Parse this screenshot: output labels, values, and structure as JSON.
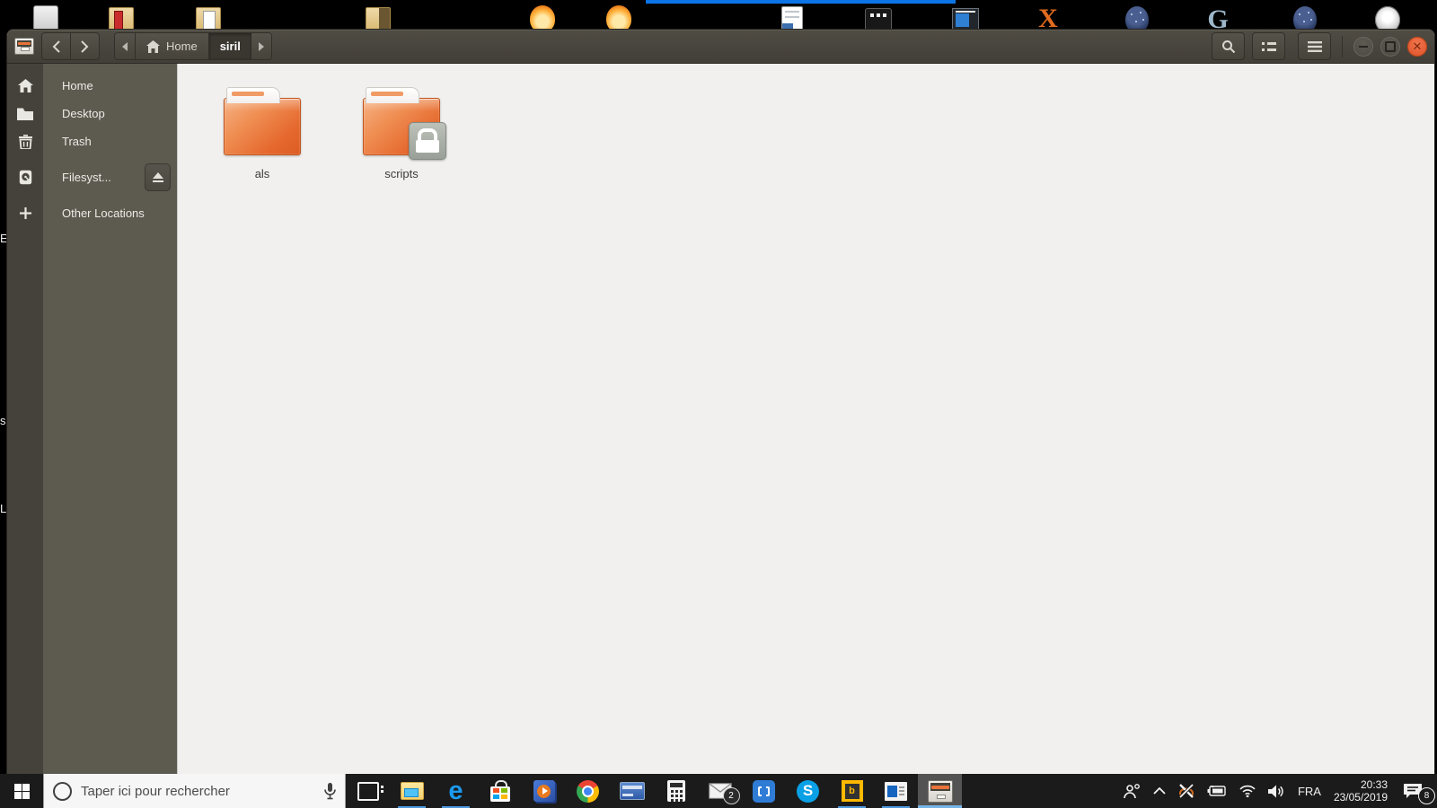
{
  "colors": {
    "accent_blue": "#0d74e8",
    "taskbar_underline": "#4e99dd",
    "close_button": "#dd4f27",
    "folder_orange": "#e5682e",
    "headerbar": "#46433b",
    "sidebar": "#5d5a50",
    "content_bg": "#f1f0ee"
  },
  "desktop": {
    "edge_labels": [
      "E",
      "s",
      "L"
    ],
    "icons": [
      "recycle-bin",
      "folder-red-book",
      "folder-documents",
      "folder-manila",
      "fire-avatar",
      "fire-list",
      "document-blue",
      "terminal-dark",
      "window-app",
      "x-server-logo",
      "planetarium-orb",
      "g-letter-app",
      "planetarium-orb-2",
      "web-sphere"
    ],
    "g_glyph": "G",
    "x_glyph": "X"
  },
  "window": {
    "headerbar": {
      "app_icon": "files-cabinet-icon",
      "path": {
        "home": "Home",
        "current": "siril"
      }
    },
    "sidebar": {
      "items": [
        {
          "label": "Home",
          "icon": "home-icon"
        },
        {
          "label": "Desktop",
          "icon": "folder-icon"
        },
        {
          "label": "Trash",
          "icon": "trash-icon"
        },
        {
          "label": "Filesyst...",
          "icon": "drive-icon",
          "has_eject": true
        },
        {
          "label": "Other Locations",
          "icon": "plus-icon"
        }
      ]
    },
    "content": {
      "folders": [
        {
          "name": "als",
          "locked": false
        },
        {
          "name": "scripts",
          "locked": true
        }
      ]
    }
  },
  "taskbar": {
    "search": {
      "placeholder": "Taper ici pour rechercher"
    },
    "apps": [
      {
        "name": "task-view",
        "running": false
      },
      {
        "name": "file-explorer",
        "running": true
      },
      {
        "name": "edge",
        "running": true,
        "glyph": "e"
      },
      {
        "name": "microsoft-store",
        "running": false
      },
      {
        "name": "films-tv",
        "running": false
      },
      {
        "name": "chrome",
        "running": false
      },
      {
        "name": "remote-keyboard",
        "running": false
      },
      {
        "name": "calculator",
        "running": false
      },
      {
        "name": "mail",
        "running": false,
        "badge": "2"
      },
      {
        "name": "connect",
        "running": false
      },
      {
        "name": "skype",
        "running": false,
        "glyph": "S"
      },
      {
        "name": "bing",
        "running": true,
        "glyph": "b"
      },
      {
        "name": "news",
        "running": true
      },
      {
        "name": "files-nautilus",
        "running": true,
        "active": true
      }
    ],
    "tray": {
      "language": "FRA",
      "time": "20:33",
      "date": "23/05/2019",
      "notification_count": "8"
    }
  }
}
